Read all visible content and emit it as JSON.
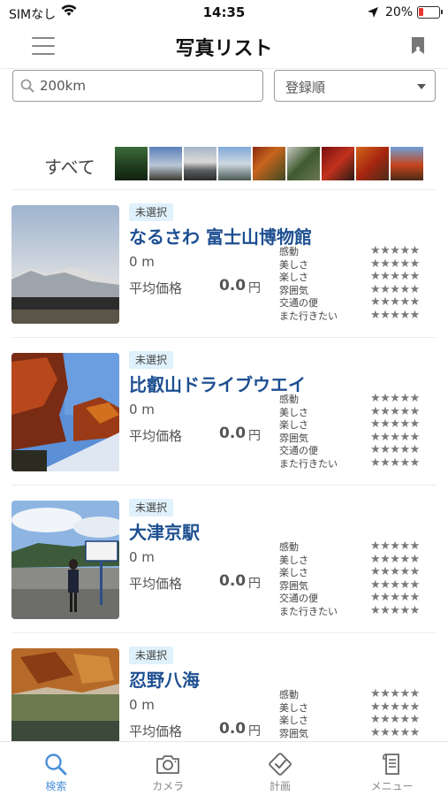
{
  "status_bar": {
    "carrier": "SIMなし",
    "time": "14:35",
    "battery": "20%"
  },
  "header": {
    "title": "写真リスト"
  },
  "search": {
    "value": "200km"
  },
  "sort": {
    "selected": "登録順"
  },
  "filter": {
    "all_label": "すべて"
  },
  "rating_labels": [
    "感動",
    "美しさ",
    "楽しさ",
    "雰囲気",
    "交通の便",
    "また行きたい"
  ],
  "stars": "★★★★★",
  "items": [
    {
      "status": "未選択",
      "name": "なるさわ 富士山博物館",
      "distance": "0 m",
      "price_label": "平均価格",
      "price": "0.0",
      "price_unit": "円"
    },
    {
      "status": "未選択",
      "name": "比叡山ドライブウエイ",
      "distance": "0 m",
      "price_label": "平均価格",
      "price": "0.0",
      "price_unit": "円"
    },
    {
      "status": "未選択",
      "name": "大津京駅",
      "distance": "0 m",
      "price_label": "平均価格",
      "price": "0.0",
      "price_unit": "円"
    },
    {
      "status": "未選択",
      "name": "忍野八海",
      "distance": "0 m",
      "price_label": "平均価格",
      "price": "0.0",
      "price_unit": "円"
    }
  ],
  "tabs": [
    {
      "label": "検索",
      "icon": "search-icon",
      "active": true
    },
    {
      "label": "カメラ",
      "icon": "camera-icon",
      "active": false
    },
    {
      "label": "計画",
      "icon": "plan-check-icon",
      "active": false
    },
    {
      "label": "メニュー",
      "icon": "menu-doc-icon",
      "active": false
    }
  ],
  "colors": {
    "accent": "#4a90d9",
    "title_blue": "#1d4f91",
    "badge_bg": "#dff1fb",
    "star_gray": "#7a7a7a"
  }
}
